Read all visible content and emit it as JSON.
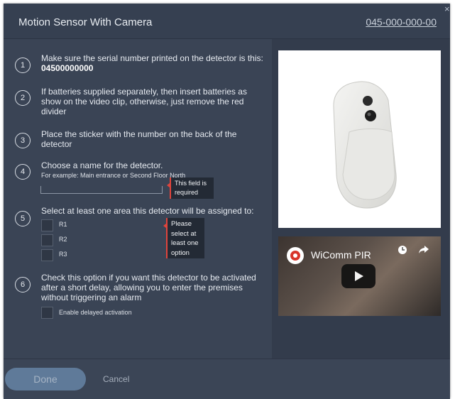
{
  "dialog": {
    "title": "Motion Sensor With Camera",
    "serial_link": "045-000-000-00",
    "close_glyph": "×"
  },
  "steps": [
    {
      "number": "1",
      "text_pre": "Make sure the serial number printed on the detector is this: ",
      "text_bold": "04500000000"
    },
    {
      "number": "2",
      "text": "If batteries supplied separately, then insert batteries as show on the video clip, otherwise, just remove the red divider"
    },
    {
      "number": "3",
      "text": "Place the sticker with the number on the back of the detector"
    },
    {
      "number": "4",
      "text": "Choose a name for the detector.",
      "hint": "For example: Main entrance or Second Floor North",
      "input_value": "",
      "error": "This field is required"
    },
    {
      "number": "5",
      "text": "Select at least one area this detector will be assigned to:",
      "areas": [
        "R1",
        "R2",
        "R3"
      ],
      "error": "Please select at least one option"
    },
    {
      "number": "6",
      "text": "Check this option if you want this detector to be activated after a short delay, allowing you to enter the premises without triggering an alarm",
      "checkbox_label": "Enable delayed activation"
    }
  ],
  "media": {
    "video_title": "WiComm PIR",
    "icons": [
      "clock-icon",
      "share-icon",
      "play-icon"
    ]
  },
  "footer": {
    "done_label": "Done",
    "cancel_label": "Cancel"
  },
  "colors": {
    "dialog_bg": "#3a4455",
    "accent_button": "#5f7a99",
    "error_marker": "#e0443c"
  }
}
